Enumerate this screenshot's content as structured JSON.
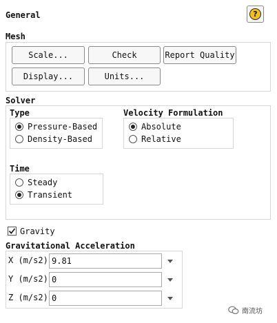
{
  "panel": {
    "title": "General"
  },
  "mesh": {
    "label": "Mesh",
    "buttons": {
      "scale": "Scale...",
      "check": "Check",
      "report_quality": "Report Quality",
      "display": "Display...",
      "units": "Units..."
    }
  },
  "solver": {
    "label": "Solver",
    "type": {
      "label": "Type",
      "options": [
        "Pressure-Based",
        "Density-Based"
      ],
      "selected": "Pressure-Based"
    },
    "velocity_formulation": {
      "label": "Velocity Formulation",
      "options": [
        "Absolute",
        "Relative"
      ],
      "selected": "Absolute"
    },
    "time": {
      "label": "Time",
      "options": [
        "Steady",
        "Transient"
      ],
      "selected": "Transient"
    }
  },
  "gravity": {
    "label": "Gravity",
    "checked": true,
    "acceleration_label": "Gravitational Acceleration",
    "fields": [
      {
        "label": "X (m/s2)",
        "value": "9.81"
      },
      {
        "label": "Y (m/s2)",
        "value": "0"
      },
      {
        "label": "Z (m/s2)",
        "value": "0"
      }
    ]
  },
  "watermark": {
    "text": "南流坊"
  }
}
